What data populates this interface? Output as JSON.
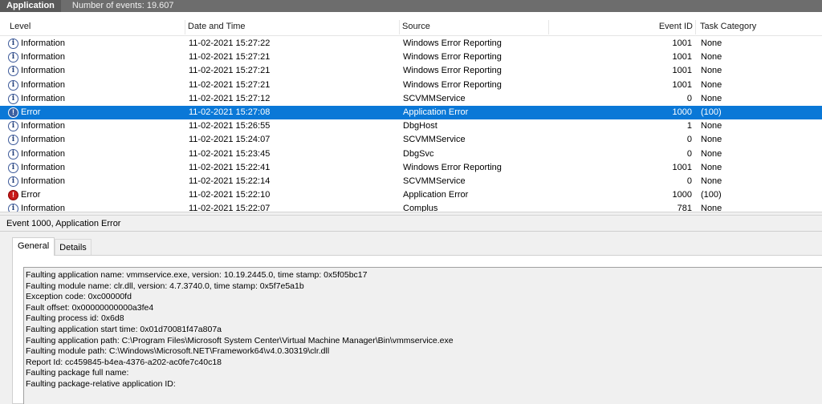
{
  "header": {
    "tab_label": "Application",
    "event_count": "Number of events: 19.607"
  },
  "columns": {
    "level": "Level",
    "date": "Date and Time",
    "source": "Source",
    "event_id": "Event ID",
    "task_category": "Task Category"
  },
  "events": [
    {
      "icon": "information-icon",
      "level": "Information",
      "date": "11-02-2021 15:27:22",
      "source": "Windows Error Reporting",
      "event_id": "1001",
      "task": "None"
    },
    {
      "icon": "information-icon",
      "level": "Information",
      "date": "11-02-2021 15:27:21",
      "source": "Windows Error Reporting",
      "event_id": "1001",
      "task": "None"
    },
    {
      "icon": "information-icon",
      "level": "Information",
      "date": "11-02-2021 15:27:21",
      "source": "Windows Error Reporting",
      "event_id": "1001",
      "task": "None"
    },
    {
      "icon": "information-icon",
      "level": "Information",
      "date": "11-02-2021 15:27:21",
      "source": "Windows Error Reporting",
      "event_id": "1001",
      "task": "None"
    },
    {
      "icon": "information-icon",
      "level": "Information",
      "date": "11-02-2021 15:27:12",
      "source": "SCVMMService",
      "event_id": "0",
      "task": "None"
    },
    {
      "icon": "error-icon",
      "level": "Error",
      "date": "11-02-2021 15:27:08",
      "source": "Application Error",
      "event_id": "1000",
      "task": "(100)",
      "selected": true
    },
    {
      "icon": "information-icon",
      "level": "Information",
      "date": "11-02-2021 15:26:55",
      "source": "DbgHost",
      "event_id": "1",
      "task": "None"
    },
    {
      "icon": "information-icon",
      "level": "Information",
      "date": "11-02-2021 15:24:07",
      "source": "SCVMMService",
      "event_id": "0",
      "task": "None"
    },
    {
      "icon": "information-icon",
      "level": "Information",
      "date": "11-02-2021 15:23:45",
      "source": "DbgSvc",
      "event_id": "0",
      "task": "None"
    },
    {
      "icon": "information-icon",
      "level": "Information",
      "date": "11-02-2021 15:22:41",
      "source": "Windows Error Reporting",
      "event_id": "1001",
      "task": "None"
    },
    {
      "icon": "information-icon",
      "level": "Information",
      "date": "11-02-2021 15:22:14",
      "source": "SCVMMService",
      "event_id": "0",
      "task": "None"
    },
    {
      "icon": "error-icon",
      "level": "Error",
      "date": "11-02-2021 15:22:10",
      "source": "Application Error",
      "event_id": "1000",
      "task": "(100)"
    },
    {
      "icon": "information-icon",
      "level": "Information",
      "date": "11-02-2021 15:22:07",
      "source": "Complus",
      "event_id": "781",
      "task": "None"
    }
  ],
  "detail": {
    "title": "Event 1000, Application Error",
    "tabs": [
      "General",
      "Details"
    ],
    "active_tab": "General",
    "lines": [
      "Faulting application name: vmmservice.exe, version: 10.19.2445.0, time stamp: 0x5f05bc17",
      "Faulting module name: clr.dll, version: 4.7.3740.0, time stamp: 0x5f7e5a1b",
      "Exception code: 0xc00000fd",
      "Fault offset: 0x00000000000a3fe4",
      "Faulting process id: 0x6d8",
      "Faulting application start time: 0x01d70081f47a807a",
      "Faulting application path: C:\\Program Files\\Microsoft System Center\\Virtual Machine Manager\\Bin\\vmmservice.exe",
      "Faulting module path: C:\\Windows\\Microsoft.NET\\Framework64\\v4.0.30319\\clr.dll",
      "Report Id: cc459845-b4ea-4376-a202-ac0fe7c40c18",
      "Faulting package full name:",
      "Faulting package-relative application ID:"
    ]
  },
  "colors": {
    "selection": "#0a78d7",
    "titlebar": "#6d6d6d",
    "error": "#c81818",
    "info_ring": "#3d5a9a"
  }
}
